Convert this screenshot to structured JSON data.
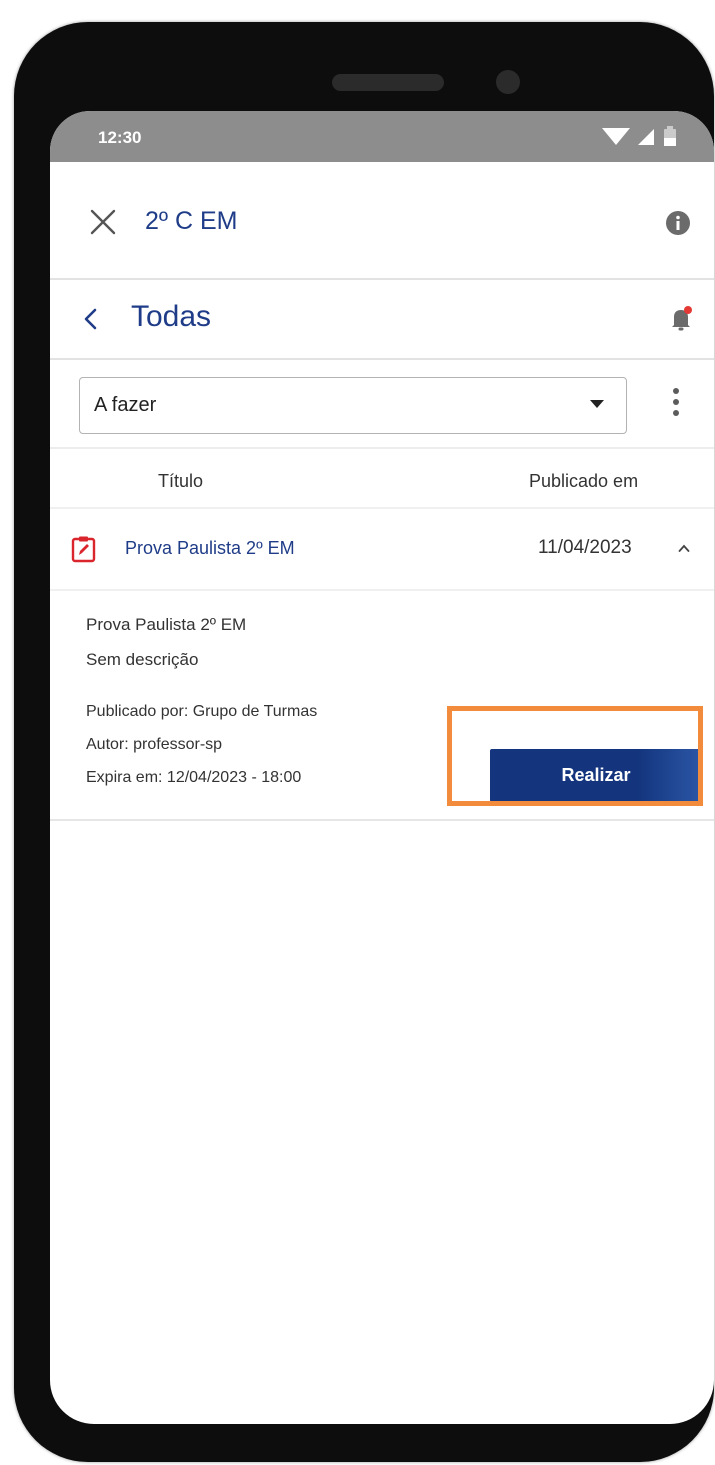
{
  "status_bar": {
    "time": "12:30"
  },
  "appbar": {
    "title": "2º C EM"
  },
  "nav": {
    "title": "Todas"
  },
  "filter": {
    "selected": "A fazer"
  },
  "table": {
    "columns": {
      "title": "Título",
      "published": "Publicado em"
    },
    "rows": [
      {
        "title": "Prova Paulista 2º EM",
        "date": "11/04/2023",
        "details": {
          "name": "Prova Paulista 2º EM",
          "description": "Sem descrição",
          "published_by": "Publicado por: Grupo de Turmas",
          "author": "Autor: professor-sp",
          "expires": "Expira em: 12/04/2023 - 18:00"
        },
        "action_label": "Realizar"
      }
    ]
  },
  "icons": {
    "close": "close-icon",
    "info": "info-icon",
    "back": "chevron-left-icon",
    "notification": "bell-icon",
    "dropdown": "caret-down-icon",
    "more": "more-vert-icon",
    "assignment": "assignment-edit-icon",
    "collapse": "chevron-up-icon"
  },
  "colors": {
    "primary": "#1f3c88",
    "button": "#14357e",
    "assignment_icon": "#d9252b",
    "highlight": "#f28c3c",
    "notification_dot": "#e53935"
  }
}
